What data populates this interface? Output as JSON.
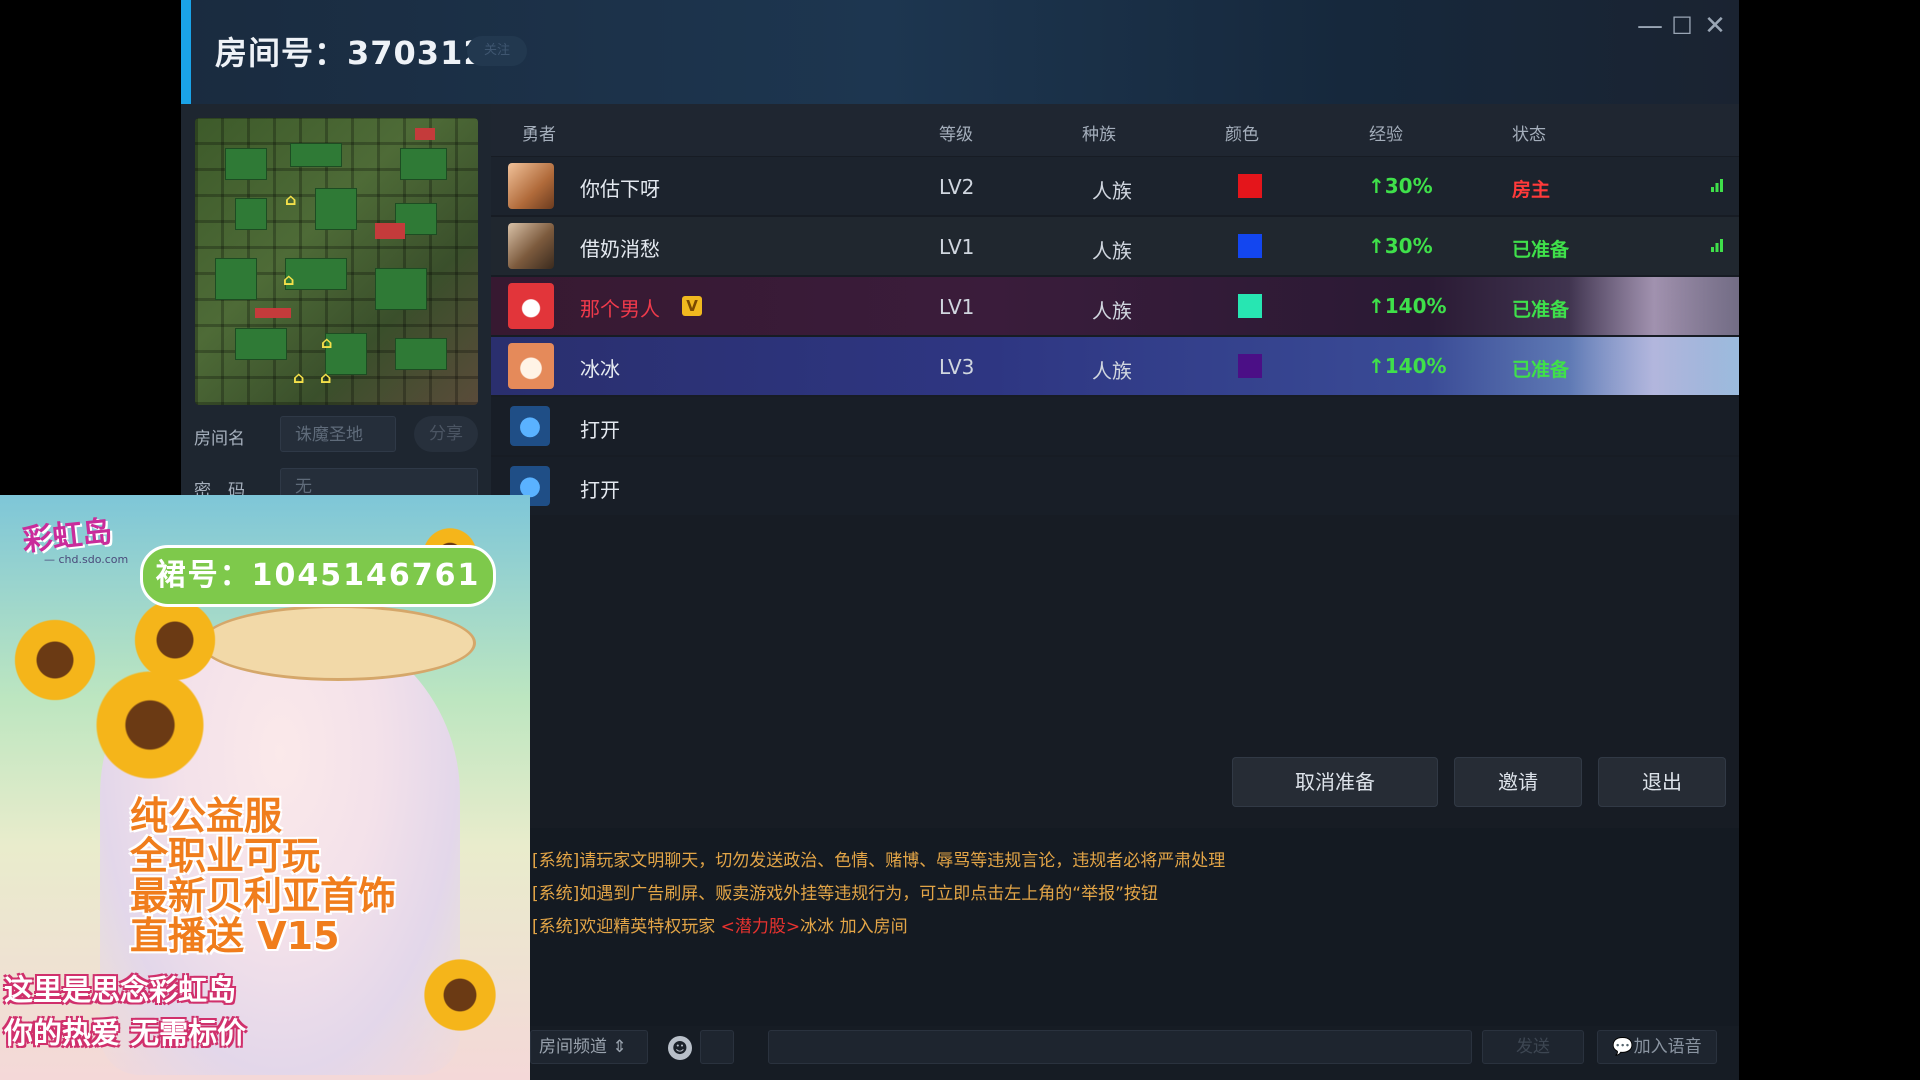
{
  "window": {
    "title_label": "房间号：370312",
    "title_pill": "关注",
    "controls": {
      "minimize": "—",
      "maximize": "☐",
      "close": "✕"
    }
  },
  "room": {
    "name_label": "房间名",
    "name_value": "诛魔圣地",
    "share_label": "分享",
    "password_label": "密　码",
    "password_value": "无"
  },
  "table": {
    "headers": [
      "勇者",
      "等级",
      "种族",
      "颜色",
      "经验",
      "状态"
    ],
    "players": [
      {
        "name": "你估下呀",
        "level": "LV2",
        "race": "人族",
        "color": "#e4151b",
        "exp": "30%",
        "status": "房主"
      },
      {
        "name": "借奶消愁",
        "level": "LV1",
        "race": "人族",
        "color": "#1346f0",
        "exp": "30%",
        "status": "已准备"
      },
      {
        "name": "那个男人",
        "level": "LV1",
        "race": "人族",
        "color": "#27e6b2",
        "exp": "140%",
        "status": "已准备",
        "vip": "V"
      },
      {
        "name": "冰冰",
        "level": "LV3",
        "race": "人族",
        "color": "#4b0f86",
        "exp": "140%",
        "status": "已准备"
      }
    ],
    "empty_slots": [
      {
        "label": "打开"
      },
      {
        "label": "打开"
      }
    ]
  },
  "actions": {
    "cancel_ready": "取消准备",
    "invite": "邀请",
    "exit": "退出"
  },
  "chat": {
    "lines": [
      {
        "text": "[系统]请玩家文明聊天，切勿发送政治、色情、赌博、辱骂等违规言论，违规者必将严肃处理"
      },
      {
        "text": "[系统]如遇到广告刷屏、贩卖游戏外挂等违规行为，可立即点击左上角的“举报”按钮"
      }
    ],
    "welcome": {
      "prefix": "[系统]欢迎精英特权玩家 ",
      "tag": "<潜力股>",
      "name": "冰冰",
      "suffix": " 加入房间"
    },
    "channel": "房间频道",
    "send_label": "发送",
    "voice_label": "加入语音"
  },
  "ad": {
    "logo": "彩虹岛",
    "logo_sub": "— chd.sdo.com",
    "qq": "裙号：1045146761",
    "lines": [
      "纯公益服",
      "全职业可玩",
      "最新贝利亚首饰",
      "直播送 V15"
    ],
    "bottom_lines": [
      "这里是思念彩虹岛",
      "你的热爱 无需标价"
    ]
  },
  "icons": {
    "close": "close-icon",
    "minimize": "minimize-icon",
    "maximize": "maximize-icon",
    "slot": "user-silhouette-icon",
    "exp": "up-arrow-icon",
    "signal": "signal-bars-icon",
    "emoji": "emoji-icon",
    "voice": "chat-bubble-icon"
  }
}
